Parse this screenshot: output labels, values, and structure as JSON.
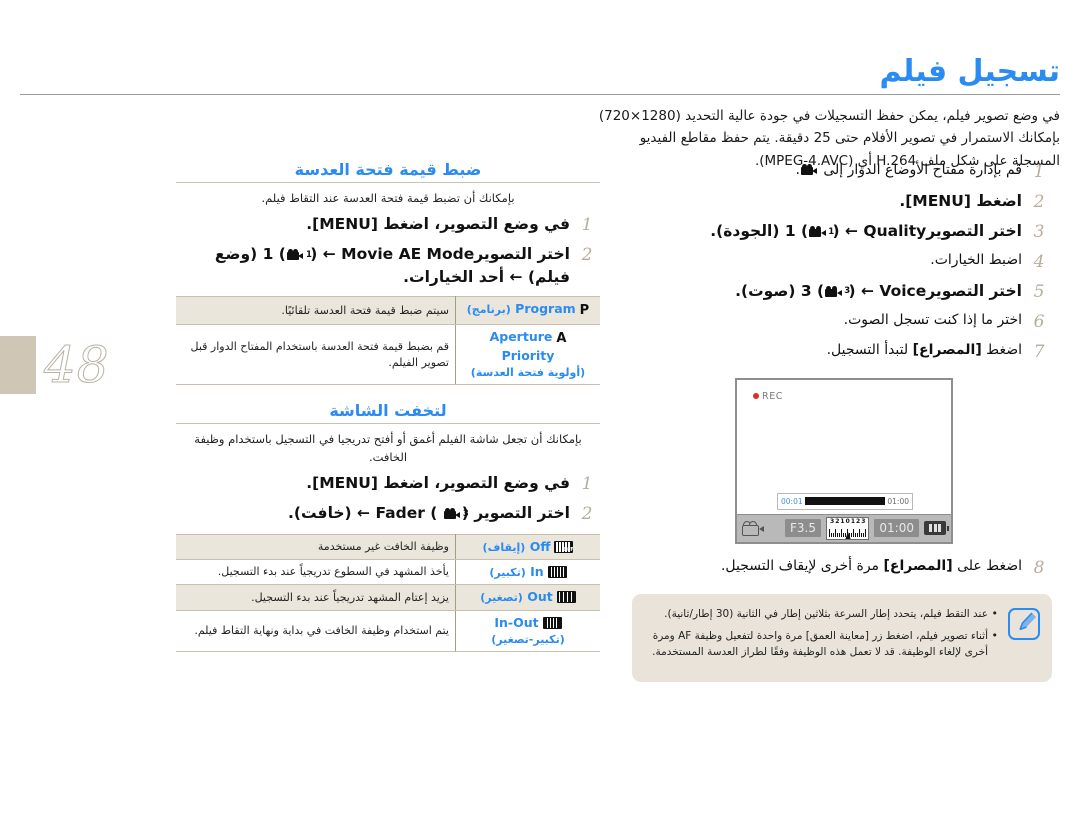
{
  "page": {
    "number": "48",
    "title": "تسجيل فيلم",
    "intro_line1": "في وضع تصوير فيلم، يمكن حفظ التسجيلات في جودة عالية التحديد (1280×720) بإمكانك الاستمرار في تصوير الأفلام حتى 25 دقيقة. يتم حفظ مقاطع الفيديو",
    "intro_line2": "المسجلة على شكل ملف H.264 أي (MPEG-4.AVC)."
  },
  "right_column": {
    "steps": [
      {
        "num": "1",
        "text_pre": "قم بإدارة مفتاح الأوضاع الدوار إلى",
        "icon": "movie-camera-icon",
        "text_post": ".",
        "style": "plain"
      },
      {
        "num": "2",
        "text_pre": "اضغط",
        "token": "[MENU]",
        "text_post": ".",
        "style": "big"
      },
      {
        "num": "3",
        "text_pre": "اختر التصوير",
        "token": "1",
        "icon": "movie-camera-icon-1",
        "arrow": "←",
        "token2": "Quality",
        "ar2": "(الجودة)",
        "text_post": ".",
        "style": "big"
      },
      {
        "num": "4",
        "text_pre": "اضبط الخيارات.",
        "style": "plain"
      },
      {
        "num": "5",
        "text_pre": "اختر التصوير",
        "token": "3",
        "icon": "movie-camera-icon-3",
        "arrow": "←",
        "token2": "Voice",
        "ar2": "(صوت)",
        "text_post": ".",
        "style": "big"
      },
      {
        "num": "6",
        "text_pre": "اختر ما إذا كنت تسجل الصوت.",
        "style": "plain"
      },
      {
        "num": "7",
        "text_pre": "اضغط",
        "token": "[المصراع]",
        "text_post": "لتبدأ التسجيل.",
        "style": "plain"
      },
      {
        "num": "8",
        "text_pre": "اضغط على",
        "token": "[المصراع]",
        "text_post": "مرة أخرى لإيقاف التسجيل.",
        "style": "plain"
      }
    ],
    "lcd": {
      "rec_label": "REC",
      "elapsed": "00:01",
      "total": "01:00",
      "aperture": "F3.5",
      "remaining": "01:00",
      "ev_scale": [
        "3",
        "2",
        "1",
        "0",
        "1",
        "2",
        "3"
      ],
      "battery": "battery-full-icon"
    },
    "note": {
      "items": [
        "عند التقط فيلم، يتحدد إطار السرعة بثلاثين إطار في الثانية (30 إطار/ثانية).",
        "أثناء تصوير فيلم، اضغط زر [معاينة العمق] مرة واحدة لتفعيل وظيفة AF ومرة أخرى لإلغاء الوظيفة. قد لا تعمل هذه الوظيفة وفقًا لطراز العدسة المستخدمة."
      ]
    }
  },
  "left_column": {
    "aperture_section": {
      "heading": "ضبط قيمة فتحة العدسة",
      "description": "بإمكانك أن تضبط قيمة فتحة العدسة عند التقاط فيلم.",
      "steps": [
        {
          "num": "1",
          "text_pre": "في وضع التصوير، اضغط",
          "token": "[MENU]",
          "text_post": ".",
          "style": "big"
        },
        {
          "num": "2",
          "text_pre": "اختر التصوير",
          "token": "1",
          "icon": "movie-camera-icon-1",
          "arrow": "←",
          "token2": "Movie AE Mode",
          "ar2": "(وضع فيلم)",
          "arrow2": "←",
          "text_post": "أحد الخيارات.",
          "style": "big"
        }
      ],
      "table": [
        {
          "glyph": "P",
          "name_en": "Program",
          "name_ar": "(برنامج)",
          "desc": "سيتم ضبط قيمة فتحة العدسة تلقائيًا.",
          "alt": true
        },
        {
          "glyph": "A",
          "name_en": "Aperture Priority",
          "name_ar": "(أولوية فتحة العدسة)",
          "desc": "قم بضبط قيمة فتحة العدسة باستخدام المفتاح الدوار قبل تصوير الفيلم.",
          "alt": false
        }
      ]
    },
    "fader_section": {
      "heading": "لتخفت الشاشة",
      "description": "بإمكانك أن تجعل شاشة الفيلم أغمق أو أفتح تدريجيا في التسجيل باستخدام وظيفة الخافت.",
      "steps": [
        {
          "num": "1",
          "text_pre": "في وضع التصوير، اضغط",
          "token": "[MENU]",
          "text_post": ".",
          "style": "big"
        },
        {
          "num": "2",
          "text_pre": "اختر التصوير",
          "token": "3",
          "icon": "movie-camera-icon-3",
          "arrow": "←",
          "token2": "Fader",
          "ar2": "(خافت)",
          "text_post": ".",
          "style": "big"
        }
      ],
      "table": [
        {
          "glyph": "fader-off-icon",
          "name_en": "Off",
          "name_ar": "(إيقاف)",
          "desc": "وظيفة الخافت غير مستخدمة",
          "alt": true
        },
        {
          "glyph": "fader-in-icon",
          "name_en": "In",
          "name_ar": "(تكبير)",
          "desc": "يأخذ المشهد في السطوع تدريجياً عند بدء التسجيل.",
          "alt": false
        },
        {
          "glyph": "fader-out-icon",
          "name_en": "Out",
          "name_ar": "(تصغير)",
          "desc": "يزيد إعتام المشهد تدريجياً عند بدء التسجيل.",
          "alt": true
        },
        {
          "glyph": "fader-inout-icon",
          "name_en": "In-Out",
          "name_ar": "(تكبير-تصغير)",
          "desc": "يتم استخدام وظيفة الخافت في بداية ونهاية التقاط فيلم.",
          "alt": false
        }
      ]
    }
  },
  "colors": {
    "accent_blue": "#2a8bf2",
    "tab_tan": "#cfc6b5",
    "table_alt": "#ebe6dc",
    "note_bg": "#e9e3d9",
    "rule": "#c9c2b4"
  }
}
